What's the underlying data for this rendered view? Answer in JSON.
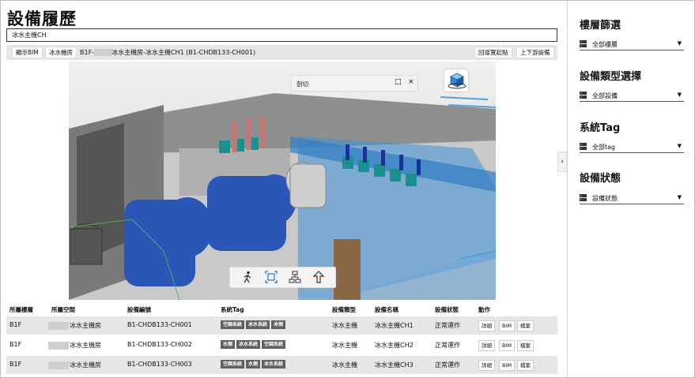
{
  "page": {
    "title": "設備履歷"
  },
  "search": {
    "value": "冰水主機CH"
  },
  "toolbar": {
    "show_bim": "顯示BIM",
    "chiller_room": "冰水機房",
    "crumb_prefix": "B1F-",
    "crumb_suffix": "冰水主機房-冰水主機CH1 (B1-CHDB133-CH001)",
    "back_to_start": "回導覽起點",
    "up_down_equipment": "上下游設備"
  },
  "viewer": {
    "section_panel_label": "剖切",
    "minimize_icon": "□",
    "close_icon": "×",
    "nav_icons": [
      "walk-icon",
      "fit-view-icon",
      "tree-icon",
      "explode-icon"
    ]
  },
  "table": {
    "headers": [
      "所屬樓層",
      "所屬空間",
      "設備編號",
      "系統Tag",
      "設備類型",
      "設備名稱",
      "設備狀態",
      "動作"
    ],
    "rows": [
      {
        "floor": "B1F",
        "space": "冰水主機房",
        "code": "B1-CHDB133-CH001",
        "tags": [
          "空調系統",
          "冰水系統",
          "冰側"
        ],
        "type": "冰水主機",
        "name": "冰水主機CH1",
        "status": "正常運作"
      },
      {
        "floor": "B1F",
        "space": "冰水主機房",
        "code": "B1-CHDB133-CH002",
        "tags": [
          "水側",
          "冰水系統",
          "空調系統"
        ],
        "type": "冰水主機",
        "name": "冰水主機CH2",
        "status": "正常運作"
      },
      {
        "floor": "B1F",
        "space": "冰水主機房",
        "code": "B1-CHDB133-CH003",
        "tags": [
          "空調系統",
          "水側",
          "冰水系統"
        ],
        "type": "冰水主機",
        "name": "冰水主機CH3",
        "status": "正常運作"
      }
    ],
    "actions": [
      "詳細",
      "BIM",
      "檔案"
    ]
  },
  "sidebar": {
    "floor_filter_title": "樓層篩選",
    "floor_filter_value": "全部樓層",
    "type_title": "設備類型選擇",
    "type_value": "全部設備",
    "tag_title": "系統Tag",
    "tag_value": "全部tag",
    "status_title": "設備狀態",
    "status_value": "設備狀態"
  },
  "colors": {
    "tag_bg": "#5f5f5f",
    "row_alt": "#e6e6e6",
    "glass": "#3d8fd6",
    "chiller": "#2a56b8"
  }
}
